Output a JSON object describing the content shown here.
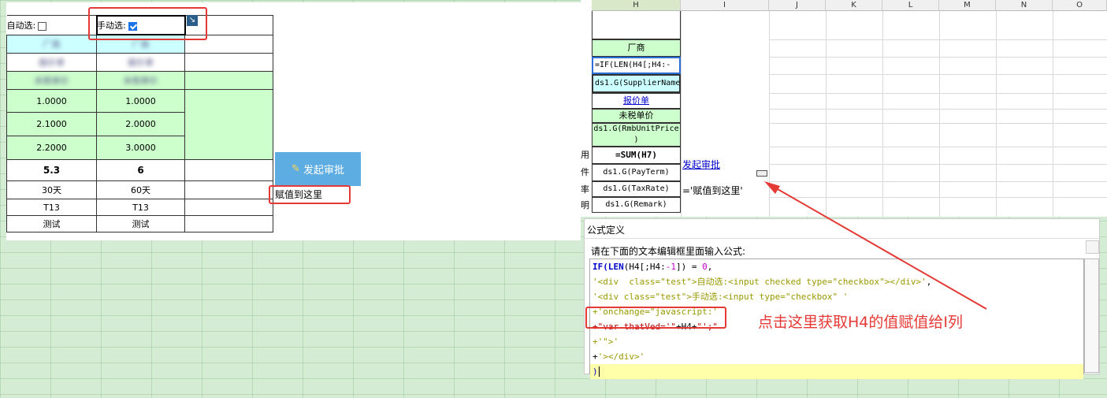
{
  "preview": {
    "auto_select_label": "自动选:",
    "manual_select_label": "手动选:",
    "header_blurred": "厂商",
    "quote_blurred": "报价单",
    "untaxed_price_blurred": "未税单价",
    "rows": [
      [
        "1.0000",
        "1.0000"
      ],
      [
        "2.1000",
        "2.0000"
      ],
      [
        "2.2000",
        "3.0000"
      ]
    ],
    "totals": [
      "5.3",
      "6"
    ],
    "pay_terms": [
      "30天",
      "60天"
    ],
    "tax": [
      "T13",
      "T13"
    ],
    "remark": [
      "测试",
      "测试"
    ],
    "launch_button": "发起审批",
    "assign_here": "赋值到这里"
  },
  "sheet": {
    "columns": [
      "H",
      "I",
      "J",
      "K",
      "L",
      "M",
      "N",
      "O"
    ],
    "vendor_label": "厂商",
    "formula_cell": "=IF(LEN(H4[;H4:-",
    "supplier_cell": "ds1.G(SupplierName",
    "quote_link": "报价单",
    "untaxed_price": "未税单价",
    "rmb_unit_price": "ds1.G(RmbUnitPrice",
    "rmb_unit_price_tail": ")",
    "sum_formula": "=SUM(H7)",
    "pay_term": "ds1.G(PayTerm)",
    "tax_rate": "ds1.G(TaxRate)",
    "remark": "ds1.G(Remark)",
    "launch_link": "发起审批",
    "assign_formula": "='赋值到这里'",
    "row_frags": [
      "用",
      "件",
      "率",
      "明"
    ]
  },
  "dialog": {
    "title": "公式定义",
    "instruction": "请在下面的文本编辑框里面输入公式:",
    "lines": {
      "l1a": "IF(LEN",
      "l1b": "(H4[;H4:",
      "l1c": "-1",
      "l1d": "]) = ",
      "l1e": "0",
      "l1f": ",",
      "l2a": "'<div  class=\"test\">自动选:<input checked type=\"checkbox\"></div>'",
      "l2b": ",",
      "l3": "'<div class=\"test\">手动选:<input type=\"checkbox\" '",
      "l4": "+'onchange=\"javascript:'",
      "l5a": "+\"var thatVed='\"",
      "l5b": "+H4+",
      "l5c": "\"';\"",
      "l6": "+'\">'",
      "l7a": "+",
      "l7b": "'></div>'",
      "l8": ")"
    }
  },
  "annotation": {
    "text": "点击这里获取H4的值赋值给I列"
  },
  "colors": {
    "red": "#e53935",
    "green_cell": "#ccffcc",
    "cyan_cell": "#ccffff",
    "button_blue": "#5dade2"
  }
}
